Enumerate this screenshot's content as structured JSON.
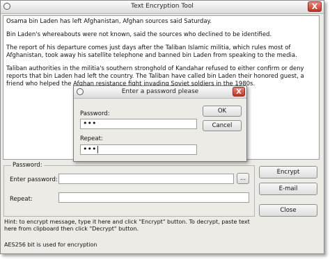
{
  "window": {
    "title": "Text Encryption Tool",
    "close_glyph": "X"
  },
  "message": {
    "paragraphs": [
      "Osama bin Laden has left Afghanistan, Afghan sources said Saturday.",
      "Bin Laden's whereabouts were not known, said the sources who declined to be identified.",
      "The report of his departure comes just days after the Taliban Islamic militia, which rules most of Afghanistan, took away his satellite telephone and banned bin Laden from speaking to the media.",
      "Taliban authorities in the militia's southern stronghold of Kandahar refused to either confirm or deny reports that bin Laden had left the country. The Taliban have called bin Laden their honored guest, a friend who helped the Afghan resistance fight invading Soviet soldiers in the 1980s."
    ]
  },
  "password_group": {
    "legend": "Password:",
    "enter_label": "Enter password:",
    "enter_value": "",
    "browse_label": "...",
    "repeat_label": "Repeat:",
    "repeat_value": ""
  },
  "buttons": {
    "encrypt": "Encrypt",
    "email": "E-mail",
    "close": "Close"
  },
  "hint": "Hint: to encrypt message, type it here and click \"Encrypt\" button. To decrypt, paste text here from clipboard then click \"Decrypt\" button.",
  "status": "AES256 bit is used for encryption",
  "dialog": {
    "title": "Enter a password please",
    "close_glyph": "X",
    "password_label": "Password:",
    "password_value": "•••",
    "repeat_label": "Repeat:",
    "repeat_value": "•••|",
    "ok": "OK",
    "cancel": "Cancel"
  },
  "icons": {
    "window_system": "window-icon",
    "dialog_system": "window-icon"
  }
}
